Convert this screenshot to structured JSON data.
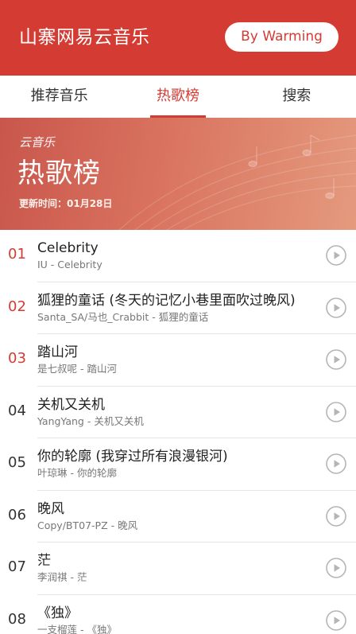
{
  "header": {
    "title": "山寨网易云音乐",
    "author_button": "By Warming"
  },
  "tabs": [
    {
      "label": "推荐音乐",
      "active": false
    },
    {
      "label": "热歌榜",
      "active": true
    },
    {
      "label": "搜索",
      "active": false
    }
  ],
  "banner": {
    "brand": "云音乐",
    "title": "热歌榜",
    "update_label": "更新时间：01月28日"
  },
  "songs": [
    {
      "rank": "01",
      "title": "Celebrity",
      "meta": "IU - Celebrity"
    },
    {
      "rank": "02",
      "title": "狐狸的童话 (冬天的记忆小巷里面吹过晚风)",
      "meta": "Santa_SA/马也_Crabbit - 狐狸的童话"
    },
    {
      "rank": "03",
      "title": "踏山河",
      "meta": "是七叔呢 - 踏山河"
    },
    {
      "rank": "04",
      "title": "关机又关机",
      "meta": "YangYang - 关机又关机"
    },
    {
      "rank": "05",
      "title": "你的轮廓 (我穿过所有浪漫银河)",
      "meta": "叶琼琳 - 你的轮廓"
    },
    {
      "rank": "06",
      "title": "晚风",
      "meta": "Copy/BT07-PZ - 晚风"
    },
    {
      "rank": "07",
      "title": "茫",
      "meta": "李润祺 - 茫"
    },
    {
      "rank": "08",
      "title": "《独》",
      "meta": "一支榴莲 - 《独》"
    }
  ],
  "icons": {
    "play": "play-circle-icon"
  },
  "colors": {
    "brand_red": "#d43c33",
    "banner_start": "#c9564c",
    "banner_end": "#e49a7e",
    "play_icon": "#b5b5b5"
  }
}
